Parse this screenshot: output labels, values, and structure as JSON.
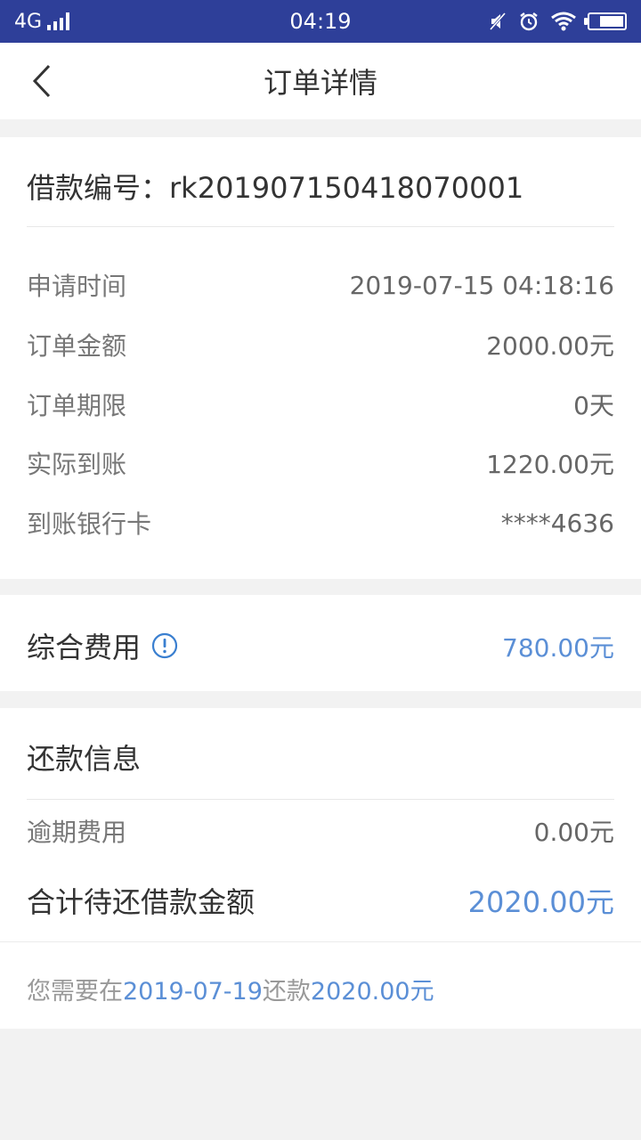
{
  "status_bar": {
    "network": "4G",
    "time": "04:19"
  },
  "nav": {
    "title": "订单详情",
    "back_icon": "chevron-left-icon"
  },
  "loan": {
    "label": "借款编号：",
    "number": "rk2019071504180700 01"
  },
  "details": [
    {
      "label": "申请时间",
      "value": "2019-07-15 04:18:16"
    },
    {
      "label": "订单金额",
      "value": "2000.00元"
    },
    {
      "label": "订单期限",
      "value": "0天"
    },
    {
      "label": "实际到账",
      "value": "1220.00元"
    },
    {
      "label": "到账银行卡",
      "value": "****4636"
    }
  ],
  "fee": {
    "label": "综合费用",
    "value": "780.00元",
    "icon": "info-circle-icon"
  },
  "repayment": {
    "title": "还款信息",
    "overdue_label": "逾期费用",
    "overdue_value": "0.00元",
    "total_label": "合计待还借款金额",
    "total_value": "2020.00元"
  },
  "notice": {
    "prefix": "您需要在",
    "date": "2019-07-19",
    "middle": "还款",
    "amount": "2020.00元"
  },
  "colors": {
    "status_bar": "#2e3f99",
    "accent": "#5b8fd6",
    "background": "#f2f2f2"
  }
}
